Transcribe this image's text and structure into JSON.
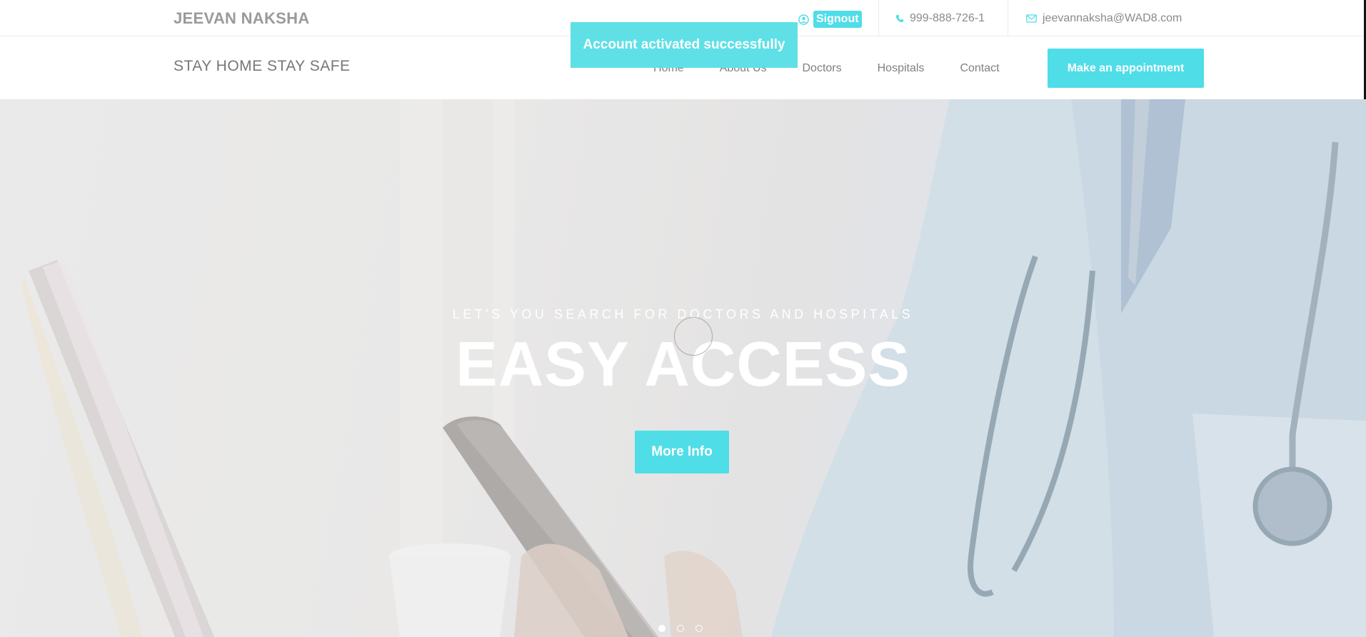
{
  "topbar": {
    "brand": "JEEVAN NAKSHA",
    "signout_label": "Signout",
    "phone": "999-888-726-1",
    "email": "jeevannaksha@WAD8.com"
  },
  "navbar": {
    "slogan": "STAY HOME STAY SAFE",
    "menu": [
      {
        "label": "Home"
      },
      {
        "label": "About Us"
      },
      {
        "label": "Doctors"
      },
      {
        "label": "Hospitals"
      },
      {
        "label": "Contact"
      }
    ],
    "cta_label": "Make an appointment"
  },
  "toast": {
    "message": "Account activated successfully"
  },
  "hero": {
    "subtitle": "LET'S YOU SEARCH FOR DOCTORS AND HOSPITALS",
    "title": "EASY ACCESS",
    "button_label": "More Info",
    "slide_count": 3,
    "active_slide": 1
  },
  "colors": {
    "accent": "#4fdde8",
    "toast": "#5ee0e6",
    "text_muted": "#808080"
  },
  "icons": {
    "user": "user-circle-icon",
    "phone": "phone-icon",
    "email": "envelope-icon"
  }
}
